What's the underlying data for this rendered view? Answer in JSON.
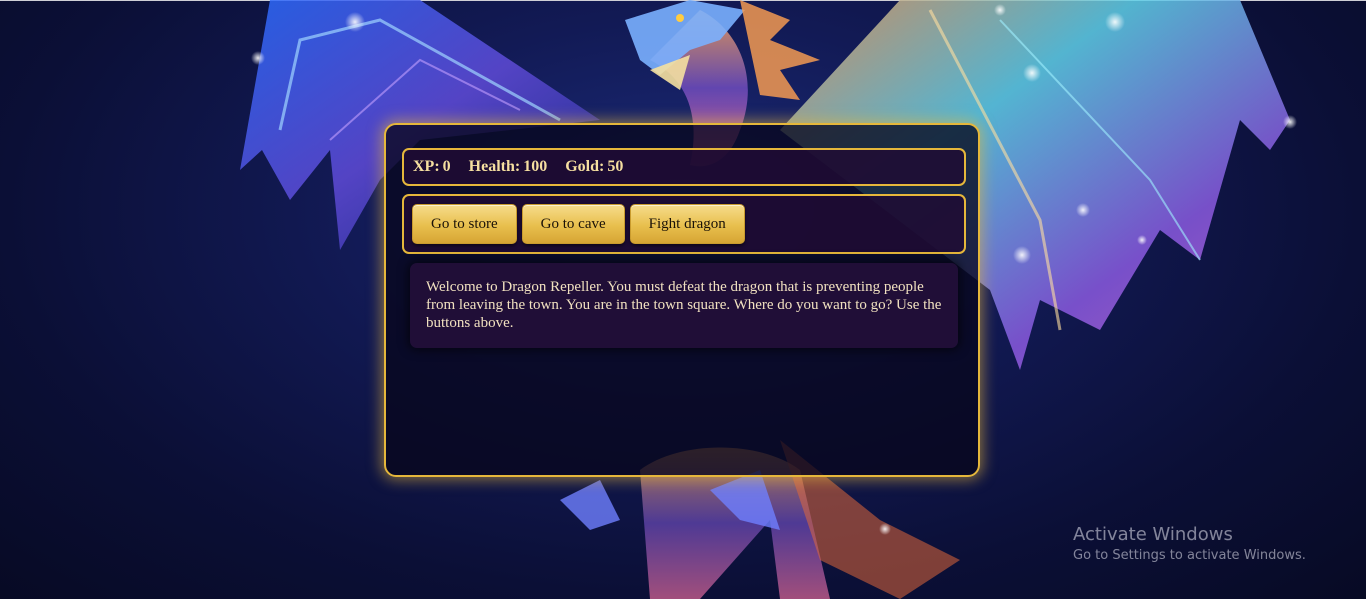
{
  "stats": {
    "xp_label": "XP:",
    "xp_value": "0",
    "health_label": "Health:",
    "health_value": "100",
    "gold_label": "Gold:",
    "gold_value": "50"
  },
  "controls": {
    "button1": "Go to store",
    "button2": "Go to cave",
    "button3": "Fight dragon"
  },
  "text": "Welcome to Dragon Repeller. You must defeat the dragon that is preventing people from leaving the town. You are in the town square. Where do you want to go? Use the buttons above.",
  "watermark": {
    "title": "Activate Windows",
    "subtitle": "Go to Settings to activate Windows."
  },
  "colors": {
    "accent_gold": "#e5b73b",
    "panel_bg": "#200c34",
    "page_bg": "#121a55"
  }
}
